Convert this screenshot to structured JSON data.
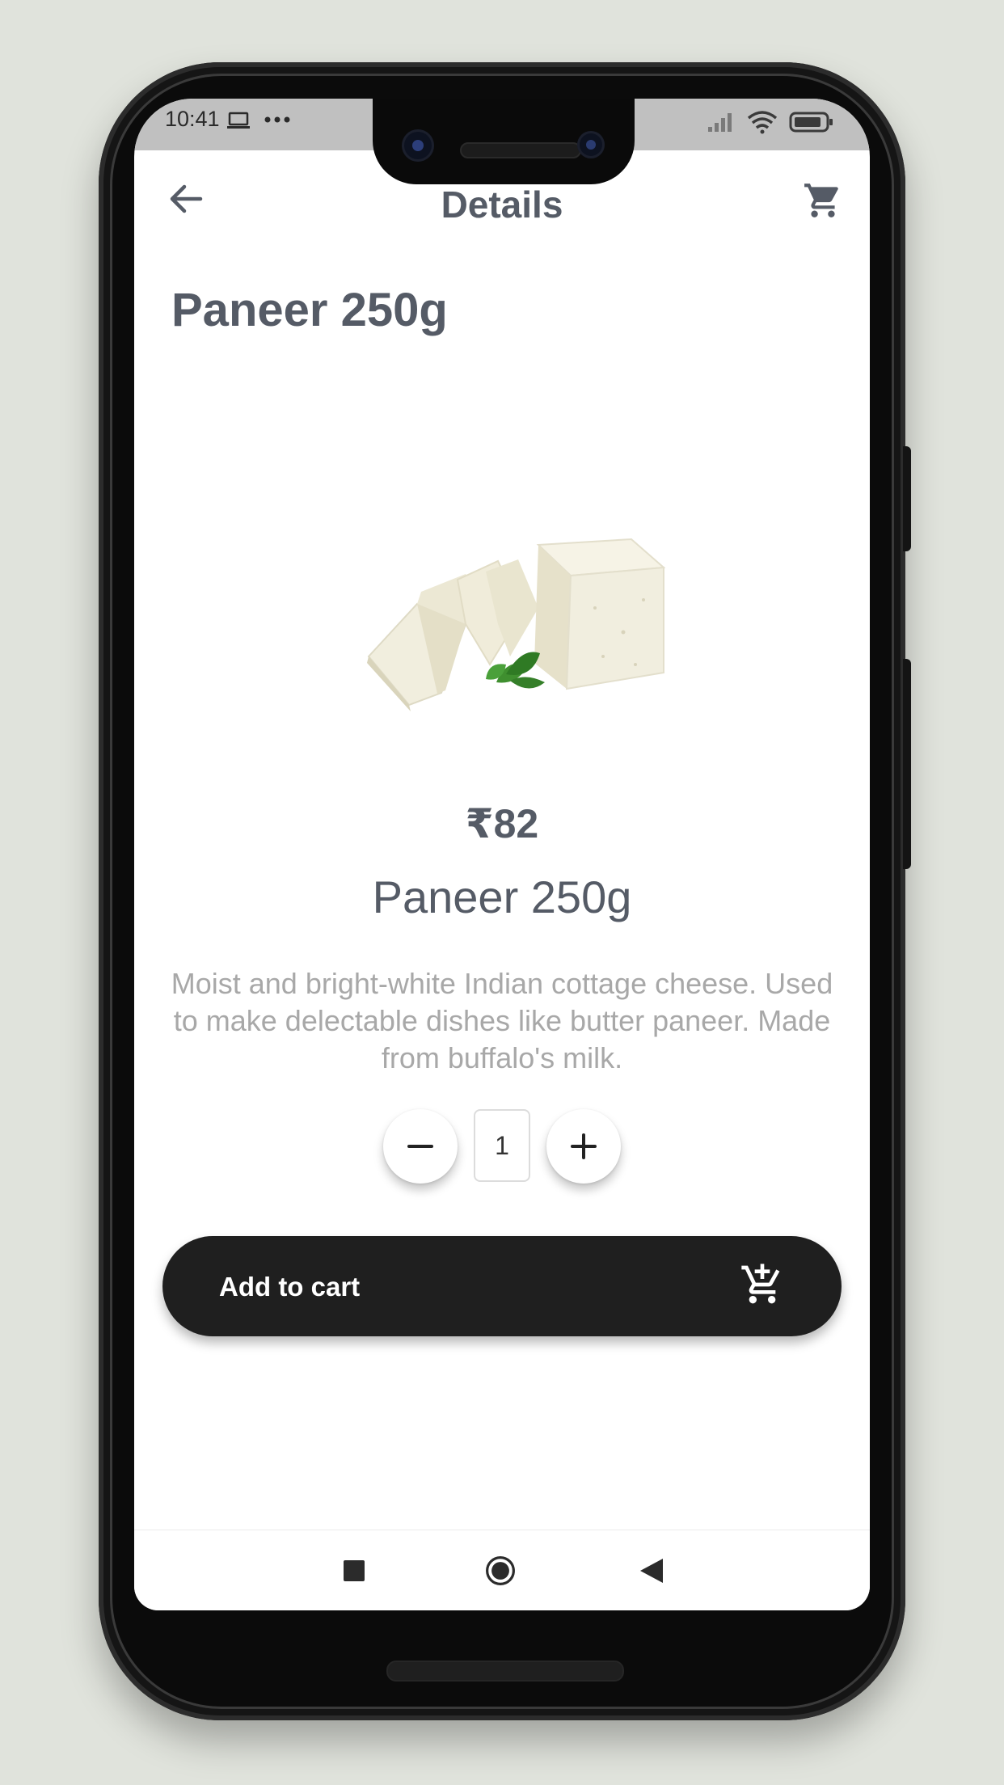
{
  "status_bar": {
    "time": "10:41",
    "icons": [
      "laptop-icon",
      "more-dots-icon",
      "signal-icon",
      "wifi-icon",
      "battery-icon"
    ]
  },
  "app_bar": {
    "title": "Details",
    "back_icon": "arrow-left-icon",
    "cart_icon": "shopping-cart-icon"
  },
  "product": {
    "heading": "Paneer 250g",
    "image": "paneer-product-image",
    "price": "₹82",
    "name": "Paneer 250g",
    "description": "Moist and bright-white Indian cottage cheese. Used to make delectable dishes like butter paneer. Made from buffalo's milk."
  },
  "quantity": {
    "value": "1",
    "decrement_icon": "minus-icon",
    "increment_icon": "plus-icon"
  },
  "add_to_cart": {
    "label": "Add to cart",
    "icon": "add-shopping-cart-icon"
  },
  "system_nav": {
    "items": [
      "recents-square-icon",
      "home-circle-icon",
      "back-triangle-icon"
    ]
  },
  "colors": {
    "text_primary": "#555b66",
    "text_muted": "#a8a8a8",
    "button_dark": "#1f1f1f",
    "status_bar": "#c0c0c0",
    "background": "#e0e3dc"
  }
}
